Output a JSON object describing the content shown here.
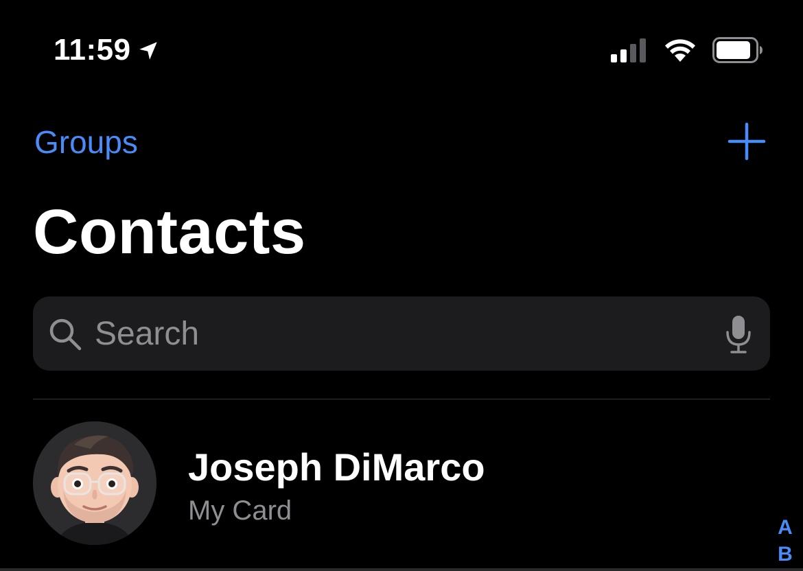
{
  "status_bar": {
    "time": "11:59",
    "icons": [
      "location-arrow-icon",
      "cellular-signal-icon",
      "wifi-icon",
      "battery-icon"
    ]
  },
  "nav": {
    "groups_label": "Groups",
    "add_icon": "plus-icon",
    "accent_color": "#4a8cf7"
  },
  "page": {
    "title": "Contacts"
  },
  "search": {
    "placeholder": "Search",
    "value": "",
    "icons": [
      "search-icon",
      "microphone-icon"
    ]
  },
  "my_card": {
    "name": "Joseph DiMarco",
    "subtitle": "My Card",
    "avatar": "memoji-avatar"
  },
  "index": {
    "letters": [
      "A",
      "B"
    ]
  }
}
